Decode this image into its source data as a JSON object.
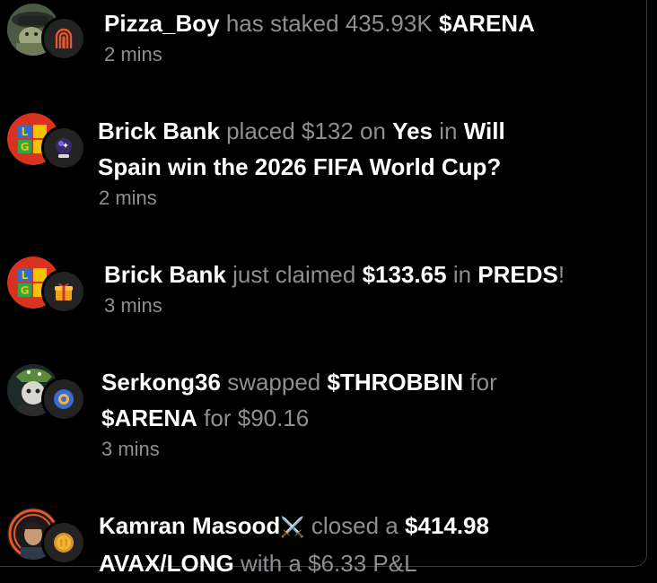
{
  "feed": {
    "items": [
      {
        "user": "Pizza_Boy",
        "action": "has staked",
        "amount": "435.93K",
        "token": "$ARENA",
        "time": "2 mins"
      },
      {
        "user": "Brick Bank",
        "action": "placed",
        "amount": "$132",
        "on": "on",
        "option": "Yes",
        "in": "in",
        "market_line1": "Will",
        "market_line2": "Spain win the 2026 FIFA World Cup?",
        "time": "2 mins"
      },
      {
        "user": "Brick Bank",
        "action": "just claimed",
        "amount": "$133.65",
        "in": "in",
        "token": "PREDS",
        "exclaim": "!",
        "time": "3 mins"
      },
      {
        "user": "Serkong36",
        "action": "swapped",
        "from_token": "$THROBBIN",
        "for1": "for",
        "to_token": "$ARENA",
        "for2": "for",
        "value": "$90.16",
        "time": "3 mins"
      },
      {
        "user": "Kamran Masood",
        "user_emoji": "⚔️",
        "action": "closed a",
        "amount": "$414.98",
        "position": "AVAX/LONG",
        "with": "with a",
        "pnl_amount": "$6.33",
        "pnl_label": "P&L"
      }
    ]
  },
  "colors": {
    "background": "#000000",
    "primary_text": "#ffffff",
    "secondary_text": "#8e8e93",
    "badge_bg": "#232323",
    "arena_orange": "#e8572c"
  }
}
